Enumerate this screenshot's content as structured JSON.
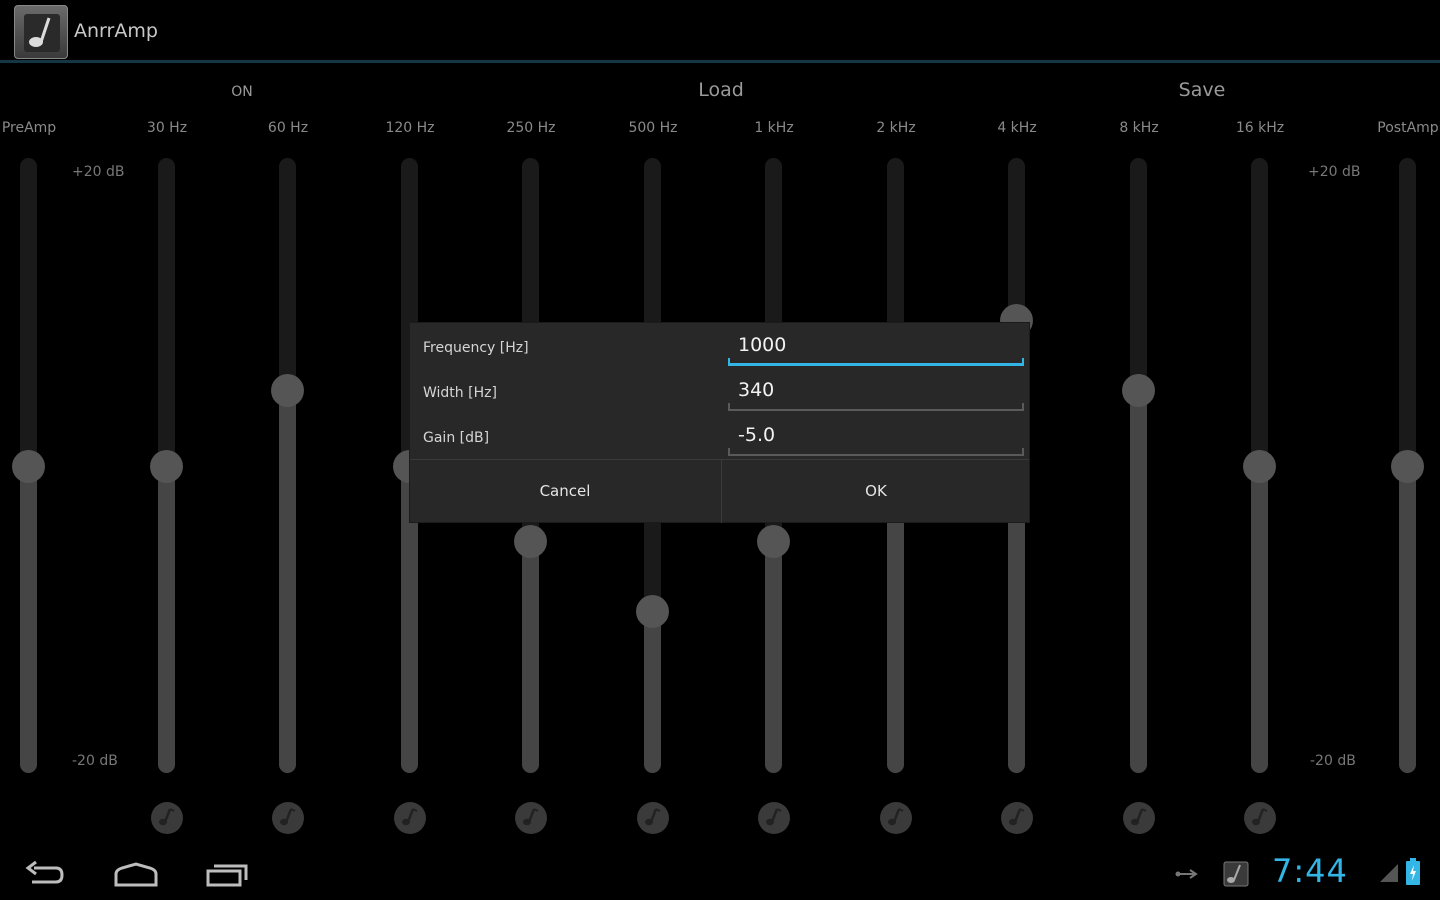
{
  "app": {
    "title": "AnrrAmp"
  },
  "controls": {
    "on_label": "ON",
    "load_label": "Load",
    "save_label": "Save"
  },
  "db_labels": {
    "left_top": "+20 dB",
    "left_bottom": "-20 dB",
    "right_top": "+20 dB",
    "right_bottom": "-20 dB"
  },
  "bands": [
    {
      "label": "PreAmp",
      "gain_fraction": 0.5
    },
    {
      "label": "30 Hz",
      "gain_fraction": 0.5
    },
    {
      "label": "60 Hz",
      "gain_fraction": 0.63
    },
    {
      "label": "120 Hz",
      "gain_fraction": 0.5
    },
    {
      "label": "250 Hz",
      "gain_fraction": 0.37
    },
    {
      "label": "500 Hz",
      "gain_fraction": 0.25
    },
    {
      "label": "1 kHz",
      "gain_fraction": 0.37
    },
    {
      "label": "2 kHz",
      "gain_fraction": 0.5
    },
    {
      "label": "4 kHz",
      "gain_fraction": 0.75
    },
    {
      "label": "8 kHz",
      "gain_fraction": 0.63
    },
    {
      "label": "16 kHz",
      "gain_fraction": 0.5
    },
    {
      "label": "PostAmp",
      "gain_fraction": 0.5
    }
  ],
  "dialog": {
    "frequency_label": "Frequency [Hz]",
    "frequency_value": "1000",
    "width_label": "Width [Hz]",
    "width_value": "340",
    "gain_label": "Gain [dB]",
    "gain_value": "-5.0",
    "cancel_label": "Cancel",
    "ok_label": "OK"
  },
  "status": {
    "time": "7:44"
  },
  "colors": {
    "accent": "#33b5e5",
    "background": "#000000",
    "dialog_bg": "#282828"
  }
}
